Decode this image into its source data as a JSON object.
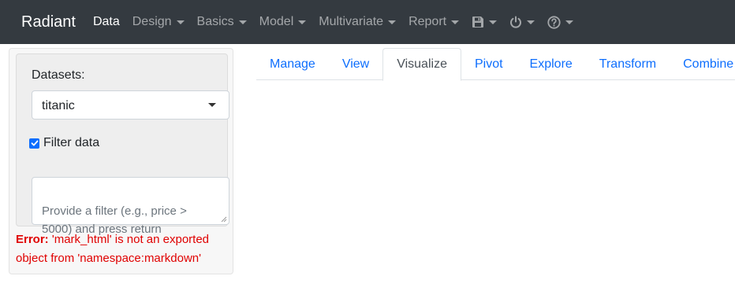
{
  "navbar": {
    "brand": "Radiant",
    "items": [
      {
        "label": "Data",
        "active": true,
        "dropdown": false
      },
      {
        "label": "Design",
        "dropdown": true
      },
      {
        "label": "Basics",
        "dropdown": true
      },
      {
        "label": "Model",
        "dropdown": true
      },
      {
        "label": "Multivariate",
        "dropdown": true
      },
      {
        "label": "Report",
        "dropdown": true
      }
    ],
    "icons": [
      "save-icon",
      "power-icon",
      "help-icon"
    ]
  },
  "sidebar": {
    "datasets_label": "Datasets:",
    "selected_dataset": "titanic",
    "filter_checkbox_label": "Filter data",
    "filter_checked": true,
    "filter_placeholder": "Provide a filter (e.g., price > 5000) and press return",
    "error_prefix": "Error:",
    "error_message": " 'mark_html' is not an exported object from 'namespace:markdown'"
  },
  "tabs": [
    {
      "label": "Manage"
    },
    {
      "label": "View"
    },
    {
      "label": "Visualize",
      "active": true
    },
    {
      "label": "Pivot"
    },
    {
      "label": "Explore"
    },
    {
      "label": "Transform"
    },
    {
      "label": "Combine"
    }
  ],
  "colors": {
    "navbar_bg": "#343a40",
    "link_blue": "#0d6efd",
    "error_red": "#e00000"
  }
}
